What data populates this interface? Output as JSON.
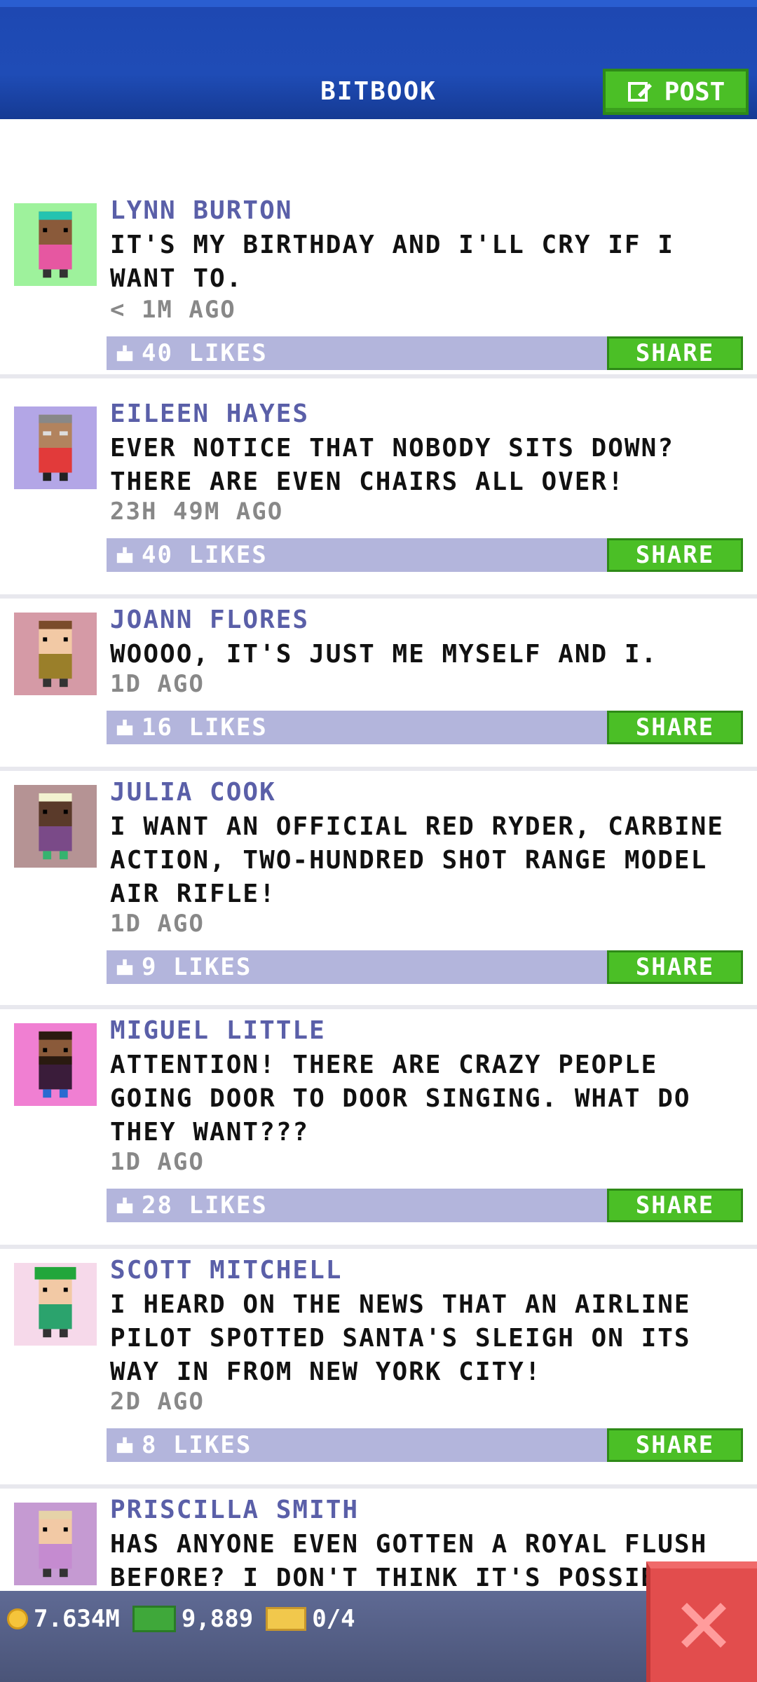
{
  "header": {
    "title": "BITBOOK",
    "post_label": "POST"
  },
  "posts": [
    {
      "name": "LYNN BURTON",
      "text": "IT'S MY BIRTHDAY AND I'LL CRY IF I WANT TO.",
      "time": "< 1M AGO",
      "likes": "40 LIKES",
      "share": "SHARE",
      "avatar_bg": "#9ef29c"
    },
    {
      "name": "EILEEN HAYES",
      "text": "EVER NOTICE THAT NOBODY SITS DOWN? THERE ARE EVEN CHAIRS ALL OVER!",
      "time": "23H 49M AGO",
      "likes": "40 LIKES",
      "share": "SHARE",
      "avatar_bg": "#b3a6e6"
    },
    {
      "name": "JOANN FLORES",
      "text": "WOOOO, IT'S JUST ME MYSELF AND I.",
      "time": "1D AGO",
      "likes": "16 LIKES",
      "share": "SHARE",
      "avatar_bg": "#d59aa6"
    },
    {
      "name": "JULIA COOK",
      "text": "I WANT AN OFFICIAL RED RYDER, CARBINE ACTION, TWO-HUNDRED SHOT RANGE MODEL AIR RIFLE!",
      "time": "1D AGO",
      "likes": "9 LIKES",
      "share": "SHARE",
      "avatar_bg": "#b59394"
    },
    {
      "name": "MIGUEL LITTLE",
      "text": "ATTENTION! THERE ARE CRAZY PEOPLE GOING DOOR TO DOOR SINGING. WHAT DO THEY WANT???",
      "time": "1D AGO",
      "likes": "28 LIKES",
      "share": "SHARE",
      "avatar_bg": "#f07fd2"
    },
    {
      "name": "SCOTT MITCHELL",
      "text": "I HEARD ON THE NEWS THAT AN AIRLINE PILOT SPOTTED SANTA'S SLEIGH ON ITS WAY IN FROM NEW YORK CITY!",
      "time": "2D AGO",
      "likes": "8 LIKES",
      "share": "SHARE",
      "avatar_bg": "#f6d9ea"
    },
    {
      "name": "PRISCILLA SMITH",
      "text": "HAS ANYONE EVEN GOTTEN A ROYAL FLUSH BEFORE? I DON'T THINK IT'S POSSIBLE.",
      "time": "",
      "likes": "",
      "share": "",
      "avatar_bg": "#c59ad2"
    }
  ],
  "footer": {
    "coins": "7.634M",
    "cash": "9,889",
    "tickets": "0/4"
  }
}
